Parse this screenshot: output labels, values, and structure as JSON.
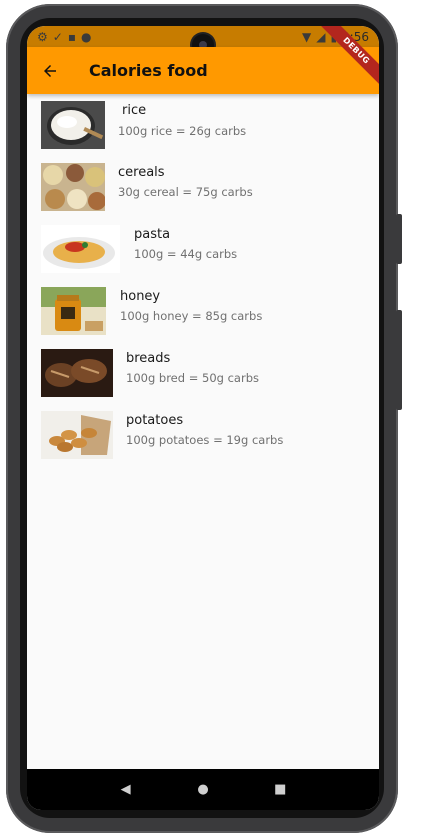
{
  "app_bar": {
    "title": "Calories food",
    "back_icon": "arrow-back-icon"
  },
  "status_bar": {
    "time": "9:56",
    "left_icons": [
      "gear-icon",
      "download-check-icon",
      "sim-card-icon",
      "circle-icon"
    ],
    "right_icons": [
      "wifi-icon",
      "signal-icon",
      "battery-icon"
    ]
  },
  "debug_banner": "DEBUG",
  "foods": [
    {
      "name": "rice",
      "desc": "100g rice = 26g carbs"
    },
    {
      "name": "cereals",
      "desc": "30g cereal = 75g carbs"
    },
    {
      "name": "pasta",
      "desc": "100g = 44g carbs"
    },
    {
      "name": "honey",
      "desc": "100g honey = 85g carbs"
    },
    {
      "name": "breads",
      "desc": "100g bred = 50g carbs"
    },
    {
      "name": "potatoes",
      "desc": "100g potatoes = 19g carbs"
    }
  ],
  "nav": {
    "back_icon": "triangle-back-icon",
    "home_icon": "circle-home-icon",
    "recents_icon": "square-recents-icon"
  },
  "colors": {
    "accent": "#ff9900",
    "status_bar": "#c77c00"
  }
}
